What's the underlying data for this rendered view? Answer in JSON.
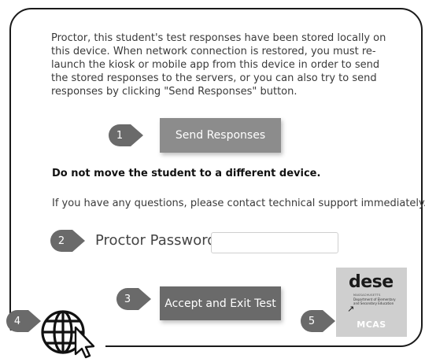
{
  "message": {
    "intro": "Proctor, this student's test responses have been stored locally on this device. When network connection is restored, you must re-launch the kiosk or mobile app from this device in order to send the stored responses to the servers, or you can also try to send responses by clicking \"Send Responses\" button.",
    "warning": "Do not move the student to a different device.",
    "support": "If you have any questions, please contact technical support immediately."
  },
  "buttons": {
    "send_responses": "Send Responses",
    "accept_exit": "Accept and Exit Test"
  },
  "password": {
    "label": "Proctor Password",
    "value": ""
  },
  "callouts": [
    "1",
    "2",
    "3",
    "4",
    "5"
  ],
  "badge": {
    "logo": "dese",
    "line1": "MASSACHUSETTS",
    "line2": "Department of Elementary and Secondary Education",
    "label": "MCAS"
  },
  "icons": {
    "language": "globe-icon",
    "cursor": "cursor-arrow-icon"
  },
  "colors": {
    "send_button": "#8c8c8c",
    "exit_button": "#6a6a6a",
    "callout": "#6a6a6a",
    "badge_bg": "#cfcfcf"
  }
}
